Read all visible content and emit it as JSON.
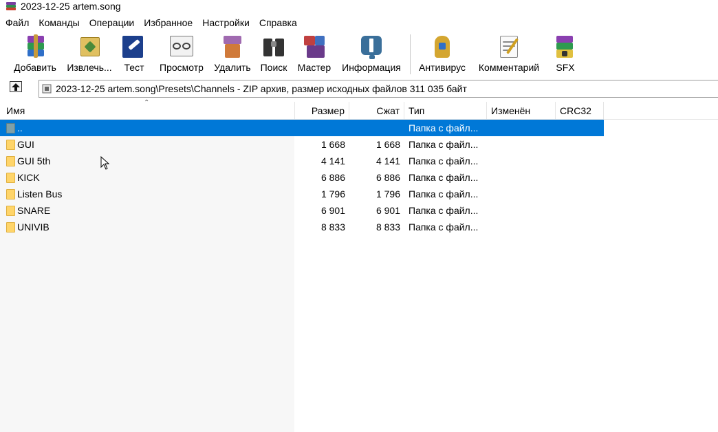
{
  "window": {
    "title": "2023-12-25 artem.song"
  },
  "menu": [
    "Файл",
    "Команды",
    "Операции",
    "Избранное",
    "Настройки",
    "Справка"
  ],
  "toolbar": {
    "add": "Добавить",
    "extract": "Извлечь...",
    "test": "Тест",
    "view": "Просмотр",
    "delete": "Удалить",
    "find": "Поиск",
    "wizard": "Мастер",
    "info": "Информация",
    "antivirus": "Антивирус",
    "comment": "Комментарий",
    "sfx": "SFX"
  },
  "address": {
    "path": "2023-12-25 artem.song\\Presets\\Channels - ZIP архив, размер исходных файлов 311 035 байт"
  },
  "columns": {
    "name": "Имя",
    "size": "Размер",
    "packed": "Сжат",
    "type": "Тип",
    "modified": "Изменён",
    "crc": "CRC32"
  },
  "files": [
    {
      "name": "..",
      "size": "",
      "packed": "",
      "type": "Папка с файл...",
      "selected": true
    },
    {
      "name": "GUI",
      "size": "1 668",
      "packed": "1 668",
      "type": "Папка с файл..."
    },
    {
      "name": "GUI 5th",
      "size": "4 141",
      "packed": "4 141",
      "type": "Папка с файл..."
    },
    {
      "name": "KICK",
      "size": "6 886",
      "packed": "6 886",
      "type": "Папка с файл..."
    },
    {
      "name": "Listen Bus",
      "size": "1 796",
      "packed": "1 796",
      "type": "Папка с файл..."
    },
    {
      "name": "SNARE",
      "size": "6 901",
      "packed": "6 901",
      "type": "Папка с файл..."
    },
    {
      "name": "UNIVIB",
      "size": "8 833",
      "packed": "8 833",
      "type": "Папка с файл..."
    }
  ],
  "colors": {
    "selection": "#0078d7",
    "folder": "#ffd56a"
  }
}
